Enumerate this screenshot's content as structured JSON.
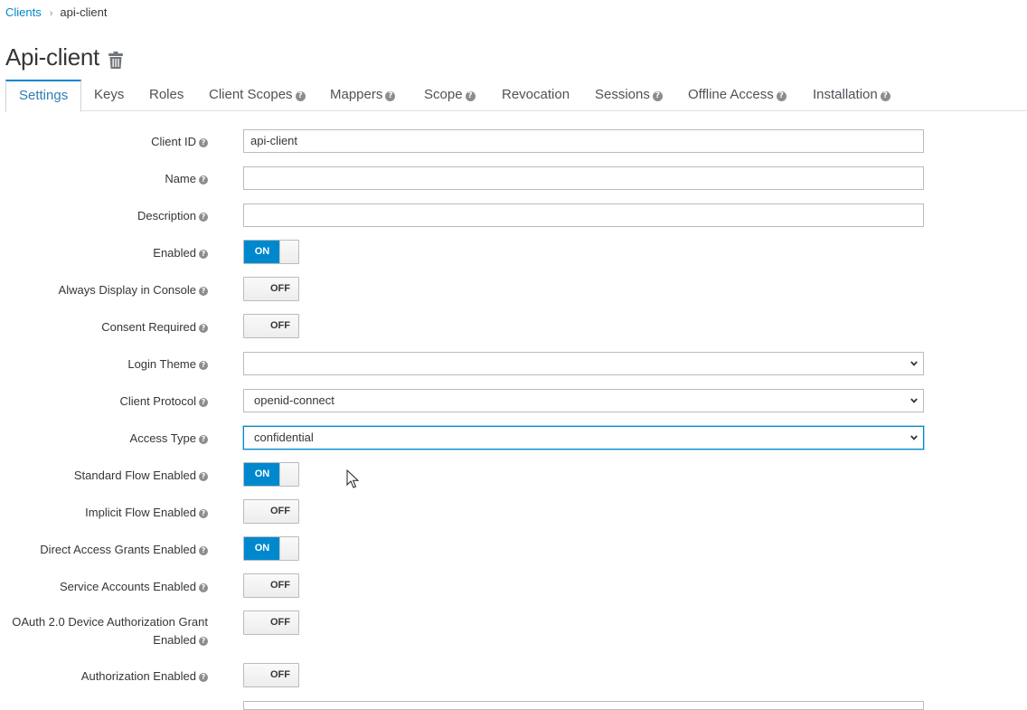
{
  "breadcrumb": {
    "parent": "Clients",
    "separator": "›",
    "current": "api-client"
  },
  "page": {
    "title": "Api-client"
  },
  "tabs": [
    {
      "label": "Settings",
      "help": false,
      "active": true
    },
    {
      "label": "Keys",
      "help": false
    },
    {
      "label": "Roles",
      "help": false
    },
    {
      "label": "Client Scopes",
      "help": true
    },
    {
      "label": "Mappers",
      "help": true
    },
    {
      "label": "Scope",
      "help": true
    },
    {
      "label": "Revocation",
      "help": false
    },
    {
      "label": "Sessions",
      "help": true
    },
    {
      "label": "Offline Access",
      "help": true
    },
    {
      "label": "Installation",
      "help": true
    }
  ],
  "form": {
    "client_id": {
      "label": "Client ID",
      "value": "api-client"
    },
    "name": {
      "label": "Name",
      "value": ""
    },
    "description": {
      "label": "Description",
      "value": ""
    },
    "enabled": {
      "label": "Enabled",
      "state": "ON"
    },
    "always_display": {
      "label": "Always Display in Console",
      "state": "OFF"
    },
    "consent_required": {
      "label": "Consent Required",
      "state": "OFF"
    },
    "login_theme": {
      "label": "Login Theme",
      "value": ""
    },
    "client_protocol": {
      "label": "Client Protocol",
      "value": "openid-connect"
    },
    "access_type": {
      "label": "Access Type",
      "value": "confidential"
    },
    "standard_flow": {
      "label": "Standard Flow Enabled",
      "state": "ON"
    },
    "implicit_flow": {
      "label": "Implicit Flow Enabled",
      "state": "OFF"
    },
    "direct_access": {
      "label": "Direct Access Grants Enabled",
      "state": "ON"
    },
    "service_accounts": {
      "label": "Service Accounts Enabled",
      "state": "OFF"
    },
    "device_grant": {
      "label_line1": "OAuth 2.0 Device Authorization Grant",
      "label_line2": "Enabled",
      "state": "OFF"
    },
    "authorization": {
      "label": "Authorization Enabled",
      "state": "OFF"
    }
  },
  "colors": {
    "accent": "#0088ce",
    "text": "#363636",
    "tab_text": "#4d5258",
    "help_icon": "#8b8d8f"
  }
}
